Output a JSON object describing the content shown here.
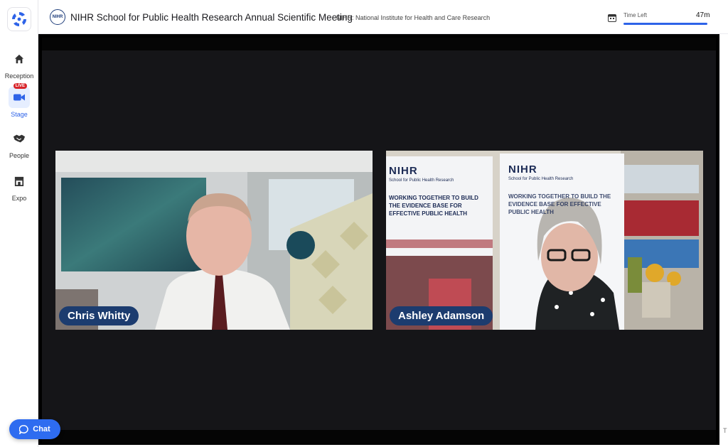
{
  "sidebar": {
    "items": [
      {
        "label": "Reception",
        "icon": "home-icon"
      },
      {
        "label": "Stage",
        "icon": "video-camera-icon",
        "badge": "LIVE"
      },
      {
        "label": "People",
        "icon": "handshake-icon"
      },
      {
        "label": "Expo",
        "icon": "store-icon"
      }
    ]
  },
  "header": {
    "title": "NIHR School for Public Health Research Annual Scientific Meeting",
    "logo_text": "NIHR",
    "organizer": "NIHR: National Institute for Health and Care Research",
    "time_left_label": "Time Left",
    "time_left_value": "47m",
    "time_left_progress": 1.0
  },
  "stage": {
    "speakers": [
      {
        "name": "Chris Whitty"
      },
      {
        "name": "Ashley Adamson"
      }
    ],
    "banner_left": {
      "brand": "NIHR",
      "sub": "School for Public Health Research",
      "headline": "WORKING TOGETHER TO BUILD THE EVIDENCE BASE FOR EFFECTIVE PUBLIC HEALTH"
    },
    "banner_right": {
      "brand": "NIHR",
      "sub": "School for Public Health Research",
      "headline": "WORKING TOGETHER TO BUILD THE EVIDENCE BASE FOR EFFECTIVE PUBLIC HEALTH"
    }
  },
  "chat": {
    "label": "Chat"
  },
  "edge_text": "T",
  "colors": {
    "accent": "#2e63e8",
    "nametag": "#1c3c6f",
    "live": "#d8262c",
    "stage_bg": "#151518"
  }
}
